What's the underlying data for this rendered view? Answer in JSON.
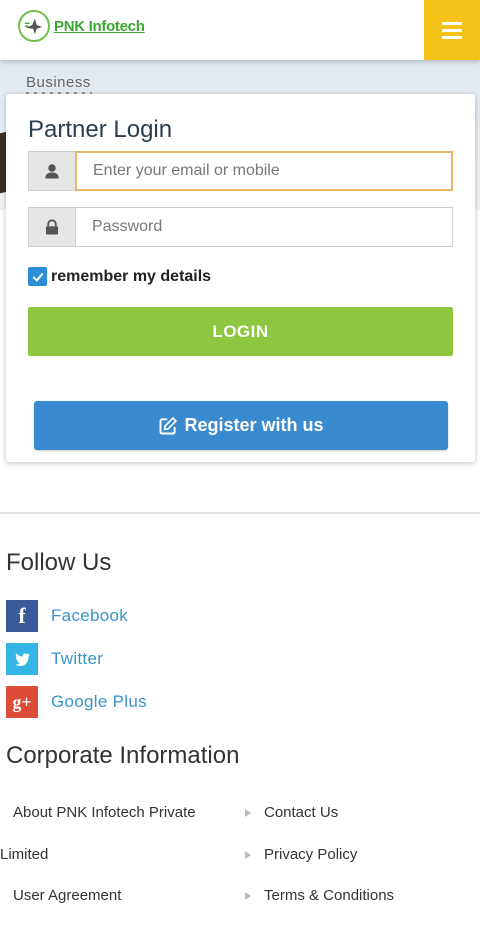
{
  "header": {
    "logo_text": "PNK Infotech",
    "menu_icon": "hamburger-menu-icon",
    "accent_color": "#f5c21a"
  },
  "banner": {
    "text": "Business"
  },
  "login": {
    "title": "Partner Login",
    "email_placeholder": "Enter your email or mobile",
    "password_placeholder": "Password",
    "remember_label": "remember my details",
    "remember_checked": true,
    "login_label": "LOGIN",
    "register_label": "Register with us",
    "login_color": "#8dc63f",
    "register_color": "#3a8ad0"
  },
  "follow": {
    "title": "Follow Us",
    "items": [
      {
        "label": "Facebook",
        "icon": "facebook-icon",
        "color": "#3b5998"
      },
      {
        "label": "Twitter",
        "icon": "twitter-icon",
        "color": "#34b5e6"
      },
      {
        "label": "Google Plus",
        "icon": "google-plus-icon",
        "color": "#dd4b39"
      }
    ]
  },
  "corporate": {
    "title": "Corporate Information",
    "left_links": [
      "About PNK Infotech Private",
      "Limited",
      "User Agreement"
    ],
    "right_links": [
      "Contact Us",
      "Privacy Policy",
      "Terms & Conditions"
    ]
  }
}
